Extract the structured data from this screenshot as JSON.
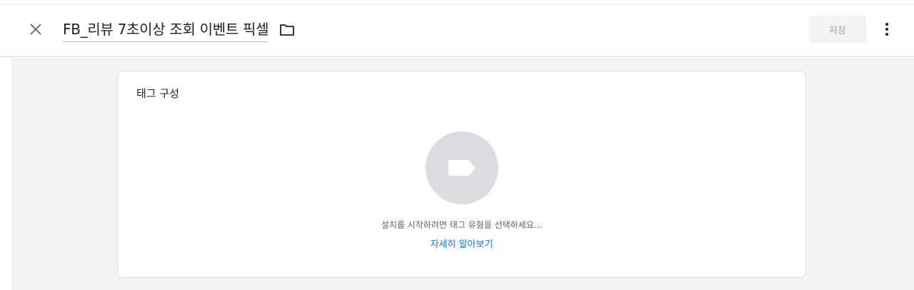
{
  "header": {
    "title": "FB_리뷰 7초이상 조회 이벤트 픽셀",
    "save_label": "저장",
    "icons": {
      "close": "close-icon",
      "folder": "folder-icon",
      "more": "more-vert-icon"
    }
  },
  "card": {
    "title": "태그 구성",
    "hint": "설치를 시작하려면 태그 유형을 선택하세요...",
    "learn_more": "자세히 알아보기",
    "icon": "tag-icon"
  },
  "colors": {
    "link": "#1a73e8",
    "canvas_bg": "#f1f3f4",
    "icon_circle": "#dadce0",
    "save_disabled_text": "#9aa0a6"
  }
}
